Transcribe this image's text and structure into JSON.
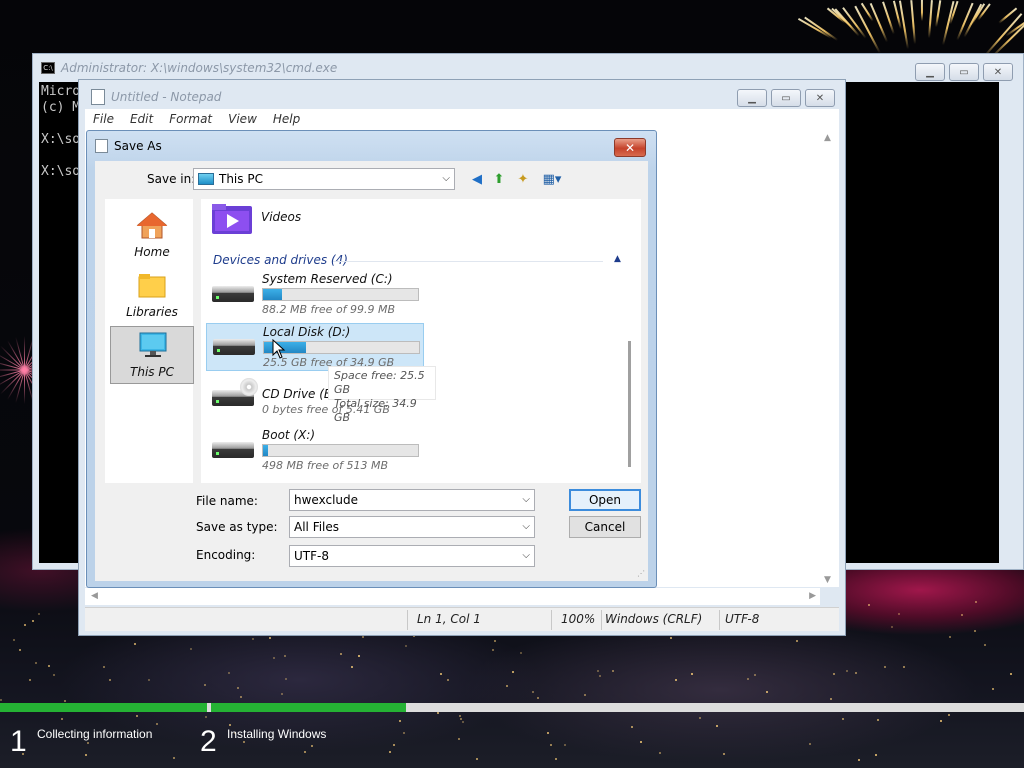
{
  "colors": {
    "selection": "#cde6f8",
    "drive_fill": "#2287c4",
    "progress_done": "#25b234",
    "progress_remaining": "#dddddd",
    "group_header": "#1e3c8c"
  },
  "cmd": {
    "title": "Administrator: X:\\windows\\system32\\cmd.exe",
    "lines": [
      "Micro",
      "(c) M",
      "",
      "X:\\so",
      "",
      "X:\\so"
    ]
  },
  "notepad": {
    "title": "Untitled - Notepad",
    "menu": [
      "File",
      "Edit",
      "Format",
      "View",
      "Help"
    ],
    "status": {
      "position": "Ln 1, Col 1",
      "zoom": "100%",
      "line_ending": "Windows (CRLF)",
      "encoding": "UTF-8"
    }
  },
  "saveas": {
    "title": "Save As",
    "save_in_label": "Save in:",
    "save_in_value": "This PC",
    "places": [
      {
        "label": "Home",
        "icon": "home-icon"
      },
      {
        "label": "Libraries",
        "icon": "libraries-icon"
      },
      {
        "label": "This PC",
        "icon": "this-pc-icon",
        "selected": true
      }
    ],
    "folder_item": "Videos",
    "group_header": "Devices and drives (4)",
    "drives": [
      {
        "name": "System Reserved (C:)",
        "free_text": "88.2 MB free of 99.9 MB",
        "used_fraction": 0.12,
        "type": "hdd"
      },
      {
        "name": "Local Disk (D:)",
        "free_text": "25.5 GB free of 34.9 GB",
        "used_fraction": 0.27,
        "type": "hdd",
        "selected": true
      },
      {
        "name": "CD Drive (E:)",
        "free_text": "0 bytes free of 5.41 GB",
        "type": "cd"
      },
      {
        "name": "Boot (X:)",
        "free_text": "498 MB free of 513 MB",
        "used_fraction": 0.03,
        "type": "hdd"
      }
    ],
    "tooltip": {
      "line1": "Space free: 25.5 GB",
      "line2": "Total size: 34.9 GB"
    },
    "file_name_label": "File name:",
    "file_name_value": "hwexclude",
    "save_type_label": "Save as type:",
    "save_type_value": "All Files",
    "encoding_label": "Encoding:",
    "encoding_value": "UTF-8",
    "open_label": "Open",
    "cancel_label": "Cancel"
  },
  "setup": {
    "steps": [
      {
        "num": "1",
        "label": "Collecting information"
      },
      {
        "num": "2",
        "label": "Installing Windows"
      }
    ],
    "progress": {
      "step1_complete": 1.0,
      "step2_fraction": 0.24
    }
  }
}
